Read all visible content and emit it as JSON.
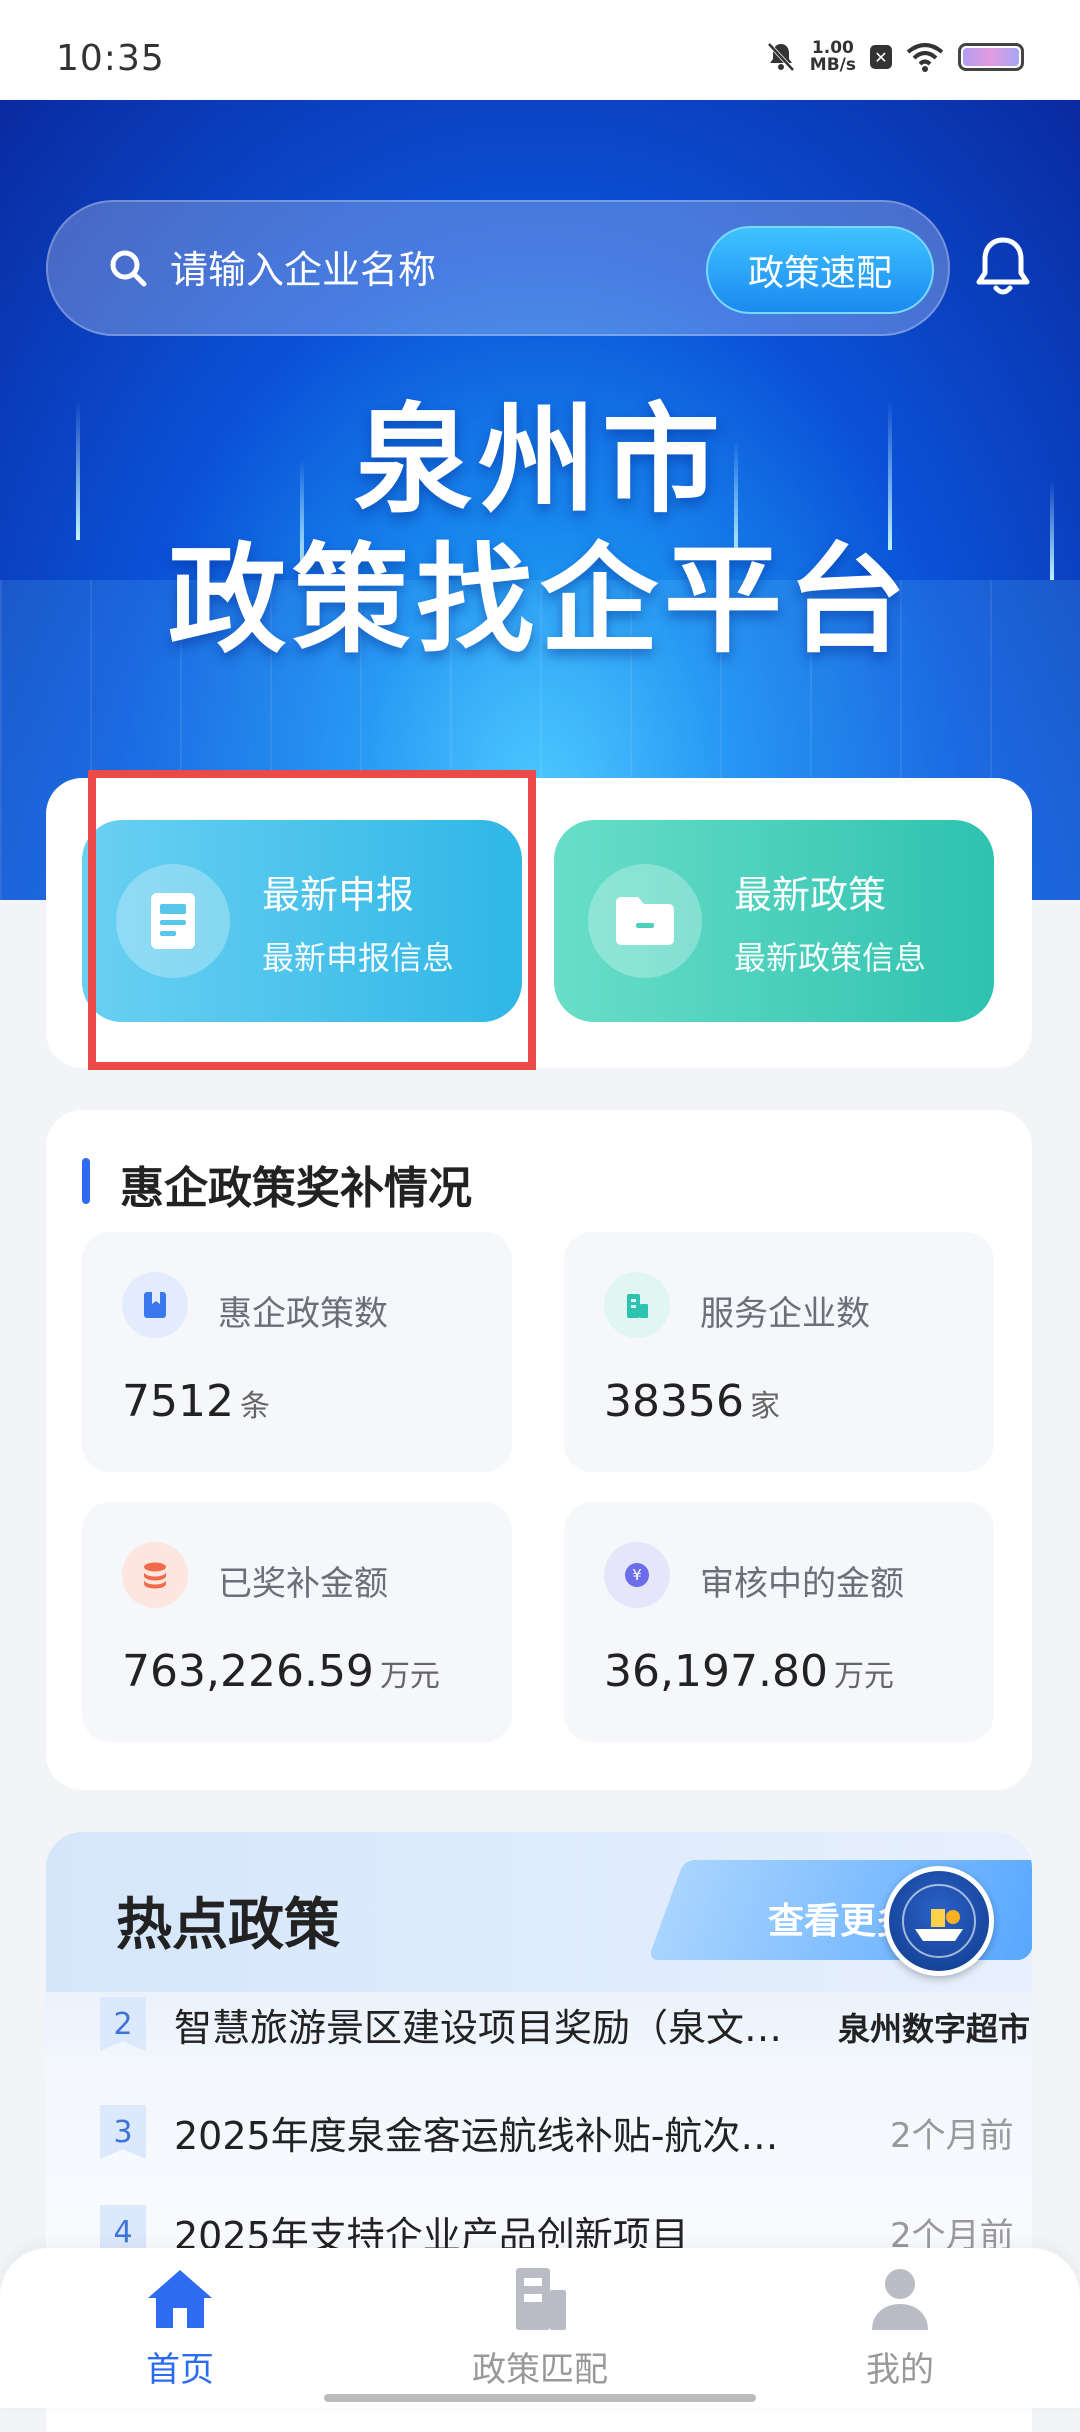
{
  "status_bar": {
    "time": "10:35",
    "speed_value": "1.00",
    "speed_unit": "MB/s"
  },
  "search": {
    "placeholder": "请输入企业名称",
    "button_label": "政策速配"
  },
  "hero": {
    "title_line1": "泉州市",
    "title_line2": "政策找企平台"
  },
  "quick_actions": [
    {
      "title": "最新申报",
      "subtitle": "最新申报信息",
      "icon": "document-icon"
    },
    {
      "title": "最新政策",
      "subtitle": "最新政策信息",
      "icon": "folder-icon"
    }
  ],
  "stats": {
    "title": "惠企政策奖补情况",
    "items": [
      {
        "label": "惠企政策数",
        "value": "7512",
        "unit": "条",
        "icon": "book-icon",
        "color": "#3a78f0"
      },
      {
        "label": "服务企业数",
        "value": "38356",
        "unit": "家",
        "icon": "building-icon",
        "color": "#2ec2b0"
      },
      {
        "label": "已奖补金额",
        "value": "763,226.59",
        "unit": "万元",
        "icon": "coins-icon",
        "color": "#f06a4c"
      },
      {
        "label": "审核中的金额",
        "value": "36,197.80",
        "unit": "万元",
        "icon": "yuan-icon",
        "color": "#6b6ee8"
      }
    ]
  },
  "hot_policies": {
    "title": "热点政策",
    "more_label": "查看更多",
    "items": [
      {
        "rank": "2",
        "text": "智慧旅游景区建设项目奖励（泉文…",
        "time": ""
      },
      {
        "rank": "3",
        "text": "2025年度泉金客运航线补贴-航次…",
        "time": "2个月前"
      },
      {
        "rank": "4",
        "text": "2025年支持企业产品创新项目",
        "time": "2个月前"
      }
    ]
  },
  "floating_badge": {
    "label": "泉州数字超市"
  },
  "bottom_nav": [
    {
      "label": "首页",
      "icon": "home-icon",
      "active": true
    },
    {
      "label": "政策匹配",
      "icon": "building-icon",
      "active": false
    },
    {
      "label": "我的",
      "icon": "person-icon",
      "active": false
    }
  ]
}
